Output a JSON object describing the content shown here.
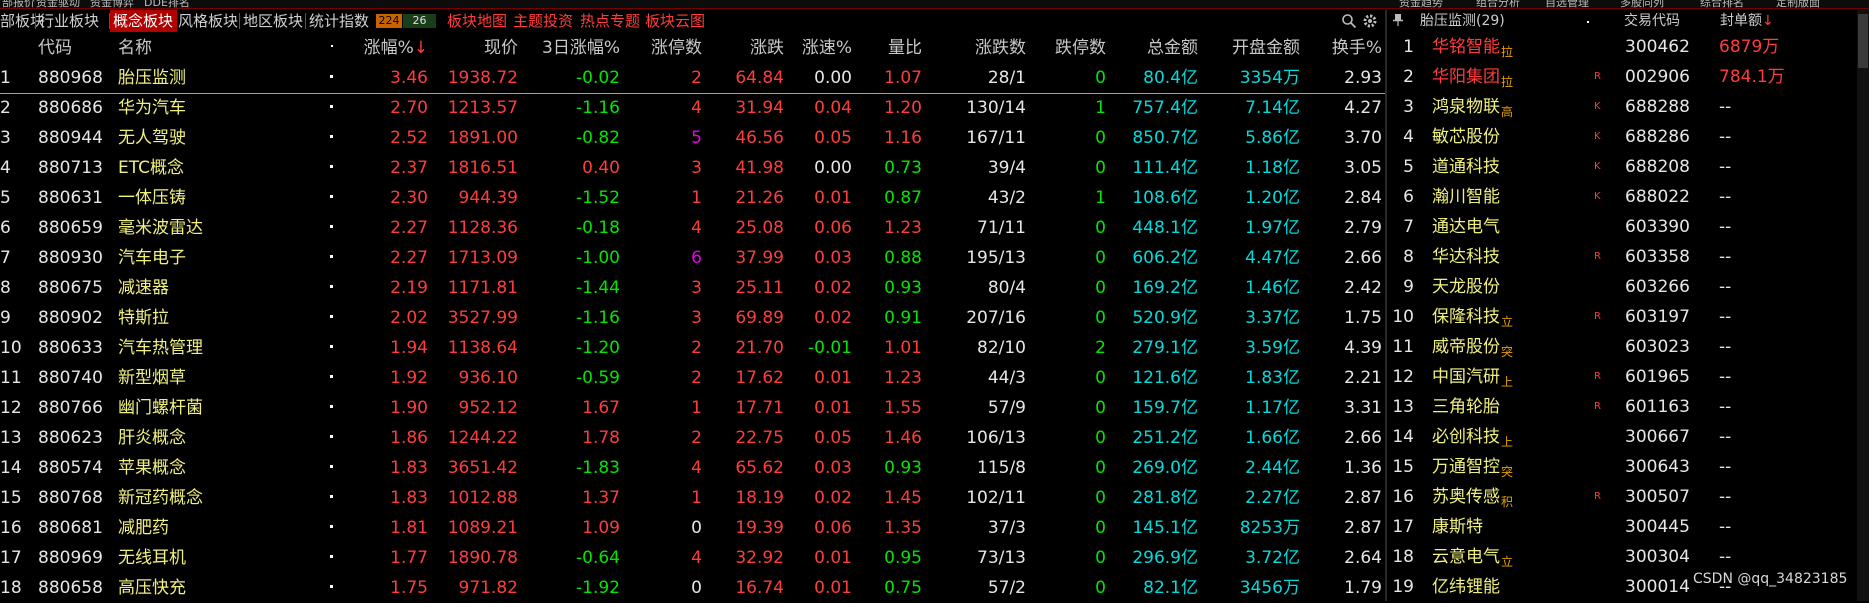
{
  "topbar": [
    "部报价",
    "资金驱动",
    "资金博弈",
    "DDE排名",
    "",
    "资金趋势",
    "组合分析",
    "自选管理",
    "多股同列",
    "综合排名",
    "定制版面"
  ],
  "tabs": [
    "部板块",
    "行业板块",
    "概念板块",
    "风格板块",
    "地区板块",
    "统计指数"
  ],
  "counts": {
    "up": "224",
    "down": "26"
  },
  "links": [
    "板块地图",
    "主题投资",
    "热点专题",
    "板块云图"
  ],
  "icons": {
    "search": "search-icon",
    "settings": "gear-icon",
    "pin": "pin-icon"
  },
  "colors": {
    "accent": "#b00000",
    "up": "#ff3c3c",
    "down": "#00e600",
    "name": "#f0f080",
    "amount": "#00dcdc"
  },
  "table": {
    "headers": {
      "code": "代码",
      "name": "名称",
      "pct": "涨幅%",
      "pct_sort": "↓",
      "price": "现价",
      "pct3": "3日涨幅%",
      "limitup": "涨停数",
      "chg": "涨跌",
      "speed": "涨速%",
      "volratio": "量比",
      "updown": "涨跌数",
      "limitdown": "跌停数",
      "amount": "总金额",
      "openamt": "开盘金额",
      "turnover": "换手%"
    },
    "rows": [
      {
        "idx": "1",
        "code": "880968",
        "name": "胎压监测",
        "pct": "3.46",
        "price": "1938.72",
        "pct3": "-0.02",
        "lu": "2",
        "chg": "64.84",
        "speed": "0.00",
        "vr": "1.07",
        "ud": "28/1",
        "ld": "0",
        "amt": "80.4亿",
        "open": "3354万",
        "to": "2.93"
      },
      {
        "idx": "2",
        "code": "880686",
        "name": "华为汽车",
        "pct": "2.70",
        "price": "1213.57",
        "pct3": "-1.16",
        "lu": "4",
        "chg": "31.94",
        "speed": "0.04",
        "vr": "1.20",
        "ud": "130/14",
        "ld": "1",
        "amt": "757.4亿",
        "open": "7.14亿",
        "to": "4.27"
      },
      {
        "idx": "3",
        "code": "880944",
        "name": "无人驾驶",
        "pct": "2.52",
        "price": "1891.00",
        "pct3": "-0.82",
        "lu": "5",
        "chg": "46.56",
        "speed": "0.05",
        "vr": "1.16",
        "ud": "167/11",
        "ld": "0",
        "amt": "850.7亿",
        "open": "5.86亿",
        "to": "3.70"
      },
      {
        "idx": "4",
        "code": "880713",
        "name": "ETC概念",
        "pct": "2.37",
        "price": "1816.51",
        "pct3": "0.40",
        "lu": "3",
        "chg": "41.98",
        "speed": "0.00",
        "vr": "0.73",
        "ud": "39/4",
        "ld": "0",
        "amt": "111.4亿",
        "open": "1.18亿",
        "to": "3.05"
      },
      {
        "idx": "5",
        "code": "880631",
        "name": "一体压铸",
        "pct": "2.30",
        "price": "944.39",
        "pct3": "-1.52",
        "lu": "1",
        "chg": "21.26",
        "speed": "0.01",
        "vr": "0.87",
        "ud": "43/2",
        "ld": "1",
        "amt": "108.6亿",
        "open": "1.20亿",
        "to": "2.84"
      },
      {
        "idx": "6",
        "code": "880659",
        "name": "毫米波雷达",
        "pct": "2.27",
        "price": "1128.36",
        "pct3": "-0.18",
        "lu": "4",
        "chg": "25.08",
        "speed": "0.06",
        "vr": "1.23",
        "ud": "71/11",
        "ld": "0",
        "amt": "448.1亿",
        "open": "1.97亿",
        "to": "2.79"
      },
      {
        "idx": "7",
        "code": "880930",
        "name": "汽车电子",
        "pct": "2.27",
        "price": "1713.09",
        "pct3": "-1.00",
        "lu": "6",
        "chg": "37.99",
        "speed": "0.03",
        "vr": "0.88",
        "ud": "195/13",
        "ld": "0",
        "amt": "606.2亿",
        "open": "4.47亿",
        "to": "2.66"
      },
      {
        "idx": "8",
        "code": "880675",
        "name": "减速器",
        "pct": "2.19",
        "price": "1171.81",
        "pct3": "-1.44",
        "lu": "3",
        "chg": "25.11",
        "speed": "0.02",
        "vr": "0.93",
        "ud": "80/4",
        "ld": "0",
        "amt": "169.2亿",
        "open": "1.46亿",
        "to": "2.42"
      },
      {
        "idx": "9",
        "code": "880902",
        "name": "特斯拉",
        "pct": "2.02",
        "price": "3527.99",
        "pct3": "-1.16",
        "lu": "3",
        "chg": "69.89",
        "speed": "0.02",
        "vr": "0.91",
        "ud": "207/16",
        "ld": "0",
        "amt": "520.9亿",
        "open": "3.37亿",
        "to": "1.75"
      },
      {
        "idx": "10",
        "code": "880633",
        "name": "汽车热管理",
        "pct": "1.94",
        "price": "1138.64",
        "pct3": "-1.20",
        "lu": "2",
        "chg": "21.70",
        "speed": "-0.01",
        "vr": "1.01",
        "ud": "82/10",
        "ld": "2",
        "amt": "279.1亿",
        "open": "3.59亿",
        "to": "4.39"
      },
      {
        "idx": "11",
        "code": "880740",
        "name": "新型烟草",
        "pct": "1.92",
        "price": "936.10",
        "pct3": "-0.59",
        "lu": "2",
        "chg": "17.62",
        "speed": "0.01",
        "vr": "1.23",
        "ud": "44/3",
        "ld": "0",
        "amt": "121.6亿",
        "open": "1.83亿",
        "to": "2.21"
      },
      {
        "idx": "12",
        "code": "880766",
        "name": "幽门螺杆菌",
        "pct": "1.90",
        "price": "952.12",
        "pct3": "1.67",
        "lu": "1",
        "chg": "17.71",
        "speed": "0.01",
        "vr": "1.55",
        "ud": "57/9",
        "ld": "0",
        "amt": "159.7亿",
        "open": "1.17亿",
        "to": "3.31"
      },
      {
        "idx": "13",
        "code": "880623",
        "name": "肝炎概念",
        "pct": "1.86",
        "price": "1244.22",
        "pct3": "1.78",
        "lu": "2",
        "chg": "22.75",
        "speed": "0.05",
        "vr": "1.46",
        "ud": "106/13",
        "ld": "0",
        "amt": "251.2亿",
        "open": "1.66亿",
        "to": "2.66"
      },
      {
        "idx": "14",
        "code": "880574",
        "name": "苹果概念",
        "pct": "1.83",
        "price": "3651.42",
        "pct3": "-1.83",
        "lu": "4",
        "chg": "65.62",
        "speed": "0.03",
        "vr": "0.93",
        "ud": "115/8",
        "ld": "0",
        "amt": "269.0亿",
        "open": "2.44亿",
        "to": "1.36"
      },
      {
        "idx": "15",
        "code": "880768",
        "name": "新冠药概念",
        "pct": "1.83",
        "price": "1012.88",
        "pct3": "1.37",
        "lu": "1",
        "chg": "18.19",
        "speed": "0.02",
        "vr": "1.45",
        "ud": "102/11",
        "ld": "0",
        "amt": "281.8亿",
        "open": "2.27亿",
        "to": "2.87"
      },
      {
        "idx": "16",
        "code": "880681",
        "name": "减肥药",
        "pct": "1.81",
        "price": "1089.21",
        "pct3": "1.09",
        "lu": "0",
        "chg": "19.39",
        "speed": "0.06",
        "vr": "1.35",
        "ud": "37/3",
        "ld": "0",
        "amt": "145.1亿",
        "open": "8253万",
        "to": "2.87"
      },
      {
        "idx": "17",
        "code": "880969",
        "name": "无线耳机",
        "pct": "1.77",
        "price": "1890.78",
        "pct3": "-0.64",
        "lu": "4",
        "chg": "32.92",
        "speed": "0.01",
        "vr": "0.95",
        "ud": "73/13",
        "ld": "0",
        "amt": "296.9亿",
        "open": "3.72亿",
        "to": "2.64"
      },
      {
        "idx": "18",
        "code": "880658",
        "name": "高压快充",
        "pct": "1.75",
        "price": "971.82",
        "pct3": "-1.92",
        "lu": "0",
        "chg": "16.74",
        "speed": "0.01",
        "vr": "0.75",
        "ud": "57/2",
        "ld": "0",
        "amt": "82.1亿",
        "open": "3456万",
        "to": "1.79"
      }
    ]
  },
  "side": {
    "title": "胎压监测(29)",
    "headers": {
      "code": "交易代码",
      "amount": "封单额",
      "sort": "↓"
    },
    "rows": [
      {
        "idx": "1",
        "name": "华铭智能",
        "sfx": "拉",
        "mk": "",
        "code": "300462",
        "amt": "6879万"
      },
      {
        "idx": "2",
        "name": "华阳集团",
        "sfx": "拉",
        "mk": "R",
        "code": "002906",
        "amt": "784.1万"
      },
      {
        "idx": "3",
        "name": "鸿泉物联",
        "sfx": "高",
        "mk": "K",
        "code": "688288",
        "amt": "--"
      },
      {
        "idx": "4",
        "name": "敏芯股份",
        "sfx": "",
        "mk": "K",
        "code": "688286",
        "amt": "--"
      },
      {
        "idx": "5",
        "name": "道通科技",
        "sfx": "",
        "mk": "K",
        "code": "688208",
        "amt": "--"
      },
      {
        "idx": "6",
        "name": "瀚川智能",
        "sfx": "",
        "mk": "K",
        "code": "688022",
        "amt": "--"
      },
      {
        "idx": "7",
        "name": "通达电气",
        "sfx": "",
        "mk": "",
        "code": "603390",
        "amt": "--"
      },
      {
        "idx": "8",
        "name": "华达科技",
        "sfx": "",
        "mk": "R",
        "code": "603358",
        "amt": "--"
      },
      {
        "idx": "9",
        "name": "天龙股份",
        "sfx": "",
        "mk": "",
        "code": "603266",
        "amt": "--"
      },
      {
        "idx": "10",
        "name": "保隆科技",
        "sfx": "立",
        "mk": "R",
        "code": "603197",
        "amt": "--"
      },
      {
        "idx": "11",
        "name": "威帝股份",
        "sfx": "突",
        "mk": "",
        "code": "603023",
        "amt": "--"
      },
      {
        "idx": "12",
        "name": "中国汽研",
        "sfx": "上",
        "mk": "R",
        "code": "601965",
        "amt": "--"
      },
      {
        "idx": "13",
        "name": "三角轮胎",
        "sfx": "",
        "mk": "R",
        "code": "601163",
        "amt": "--"
      },
      {
        "idx": "14",
        "name": "必创科技",
        "sfx": "上",
        "mk": "",
        "code": "300667",
        "amt": "--"
      },
      {
        "idx": "15",
        "name": "万通智控",
        "sfx": "突",
        "mk": "",
        "code": "300643",
        "amt": "--"
      },
      {
        "idx": "16",
        "name": "苏奥传感",
        "sfx": "积",
        "mk": "R",
        "code": "300507",
        "amt": "--"
      },
      {
        "idx": "17",
        "name": "康斯特",
        "sfx": "",
        "mk": "",
        "code": "300445",
        "amt": "--"
      },
      {
        "idx": "18",
        "name": "云意电气",
        "sfx": "立",
        "mk": "",
        "code": "300304",
        "amt": "--"
      },
      {
        "idx": "19",
        "name": "亿纬锂能",
        "sfx": "",
        "mk": "",
        "code": "300014",
        "amt": "--"
      }
    ]
  },
  "watermark": "CSDN @qq_34823185"
}
